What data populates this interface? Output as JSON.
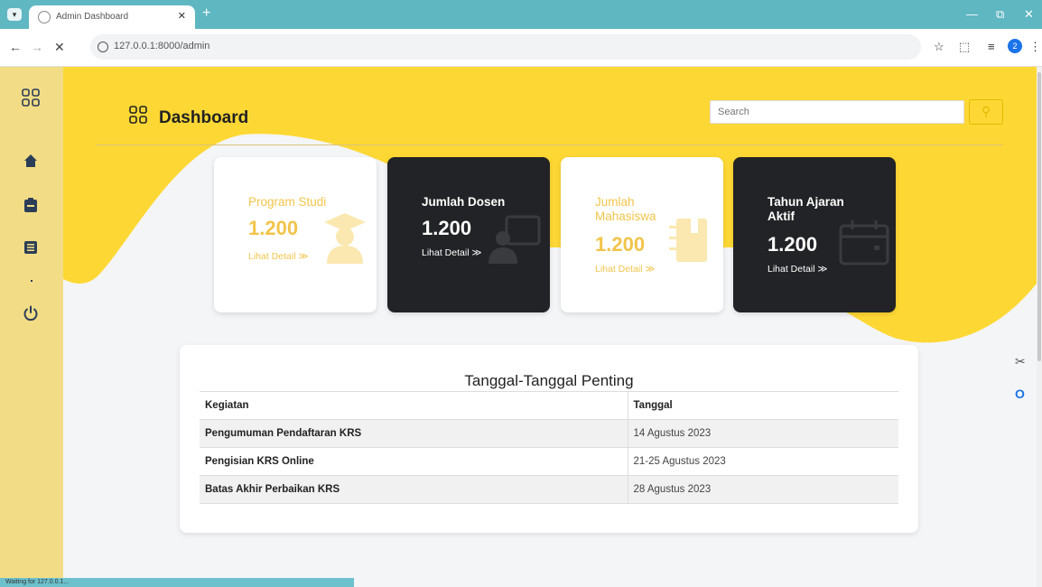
{
  "browser": {
    "tab_title": "Admin Dashboard",
    "url": "127.0.0.1:8000/admin",
    "profile_initial": "2"
  },
  "header": {
    "title": "Dashboard",
    "search_placeholder": "Search"
  },
  "cards": [
    {
      "title": "Program Studi",
      "value": "1.200",
      "link": "Lihat Detail ≫",
      "icon": "graduate-icon"
    },
    {
      "title": "Jumlah Dosen",
      "value": "1.200",
      "link": "Lihat Detail ≫",
      "icon": "teacher-board-icon"
    },
    {
      "title": "Jumlah Mahasiswa",
      "value": "1.200",
      "link": "Lihat Detail ≫",
      "icon": "notebook-icon"
    },
    {
      "title": "Tahun Ajaran Aktif",
      "value": "1.200",
      "link": "Lihat Detail ≫",
      "icon": "calendar-icon"
    }
  ],
  "dates_panel": {
    "title": "Tanggal-Tanggal Penting",
    "headers": [
      "Kegiatan",
      "Tanggal"
    ],
    "rows": [
      [
        "Pengumuman Pendaftaran KRS",
        "14 Agustus 2023"
      ],
      [
        "Pengisian KRS Online",
        "21-25 Agustus 2023"
      ],
      [
        "Batas Akhir Perbaikan KRS",
        "28 Agustus 2023"
      ]
    ]
  },
  "status_bar": "Waiting for 127.0.0.1...",
  "colors": {
    "accent": "#fdd835",
    "sidebar": "#f2dd86",
    "dark_card": "#222326",
    "light_text": "#f2c44a"
  }
}
